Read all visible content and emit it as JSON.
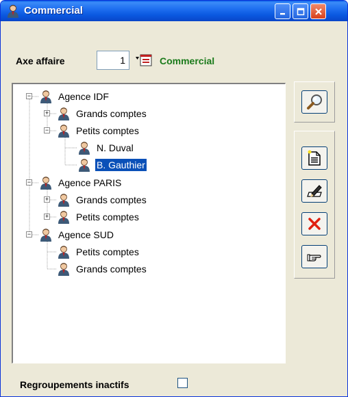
{
  "window": {
    "title": "Commercial"
  },
  "filter": {
    "label": "Axe affaire",
    "value": "1",
    "selected_name": "Commercial"
  },
  "tree": {
    "nodes": [
      {
        "label": "Agence IDF"
      },
      {
        "label": "Grands comptes"
      },
      {
        "label": "Petits comptes"
      },
      {
        "label": "N. Duval"
      },
      {
        "label": "B. Gauthier",
        "selected": true
      },
      {
        "label": "Agence PARIS"
      },
      {
        "label": "Grands comptes"
      },
      {
        "label": "Petits comptes"
      },
      {
        "label": "Agence SUD"
      },
      {
        "label": "Petits comptes"
      },
      {
        "label": "Grands comptes"
      }
    ]
  },
  "toolbar": {
    "search_icon": "magnifier-icon",
    "new_icon": "new-document-icon",
    "edit_icon": "edit-pen-icon",
    "delete_icon": "delete-x-icon",
    "move_icon": "pointing-hand-icon"
  },
  "footer": {
    "inactive_label": "Regroupements inactifs",
    "inactive_checked": false
  },
  "colors": {
    "titlebar": "#0a58e0",
    "accent_green": "#1a7a1a",
    "selection": "#0a50b8"
  }
}
